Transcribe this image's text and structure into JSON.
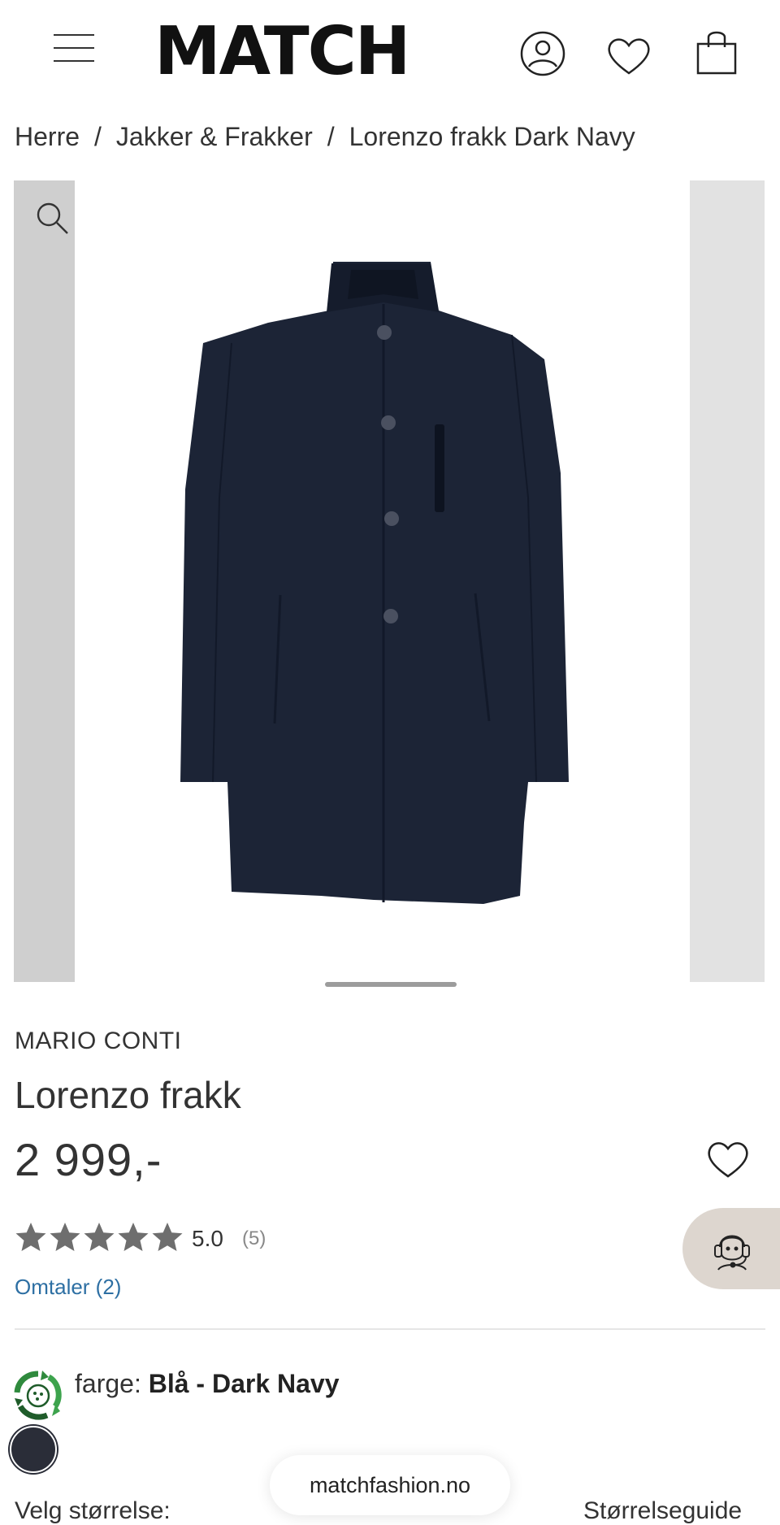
{
  "header": {
    "logo": "MATCH",
    "icons": [
      "menu-icon",
      "account-icon",
      "heart-icon",
      "shopping-bag-icon"
    ]
  },
  "breadcrumb": {
    "items": [
      "Herre",
      "Jakker & Frakker",
      "Lorenzo frakk Dark Navy"
    ],
    "separator": "/"
  },
  "product": {
    "brand": "MARIO CONTI",
    "name": "Lorenzo frakk",
    "price": "2 999,-",
    "rating": "5.0",
    "rating_count": "(5)",
    "stars": 5,
    "reviews_link": "Omtaler (2)",
    "color_prefix": "farge:",
    "color_value": "Blå - Dark Navy",
    "swatch_color": "#2a2d38"
  },
  "size": {
    "label": "Velg størrelse:",
    "guide": "Størrelseguide"
  },
  "browser": {
    "url": "matchfashion.no"
  },
  "colors": {
    "coat": "#1c2436",
    "link": "#2d6fa3",
    "star": "#6e6e6e",
    "support_bg": "#ddd6cf"
  }
}
